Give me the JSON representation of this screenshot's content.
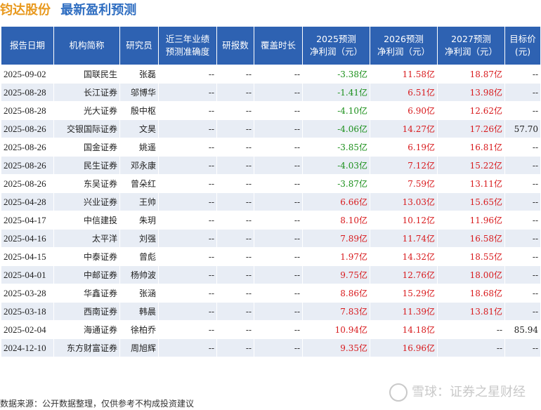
{
  "header": {
    "stock_name": "钧达股份",
    "subtitle": "最新盈利预测"
  },
  "table": {
    "columns": [
      "报告日期",
      "机构简称",
      "研究员",
      "近三年业绩\n预测准确度",
      "研报数",
      "覆盖时长",
      "2025预测\n净利润（元）",
      "2026预测\n净利润（元）",
      "2027预测\n净利润（元）",
      "目标价\n(元)"
    ],
    "rows": [
      [
        "2025-09-02",
        "国联民生",
        "张磊",
        "--",
        "--",
        "--",
        "-3.38亿",
        "11.58亿",
        "18.87亿",
        "--"
      ],
      [
        "2025-08-28",
        "长江证券",
        "邬博华",
        "--",
        "--",
        "--",
        "-1.41亿",
        "6.51亿",
        "13.98亿",
        "--"
      ],
      [
        "2025-08-28",
        "光大证券",
        "殷中枢",
        "--",
        "--",
        "--",
        "-4.10亿",
        "6.90亿",
        "12.62亿",
        "--"
      ],
      [
        "2025-08-26",
        "交银国际证券",
        "文昊",
        "--",
        "--",
        "--",
        "-4.06亿",
        "14.27亿",
        "17.26亿",
        "57.70"
      ],
      [
        "2025-08-26",
        "国金证券",
        "姚遥",
        "--",
        "--",
        "--",
        "-3.85亿",
        "6.19亿",
        "16.81亿",
        "--"
      ],
      [
        "2025-08-26",
        "民生证券",
        "邓永康",
        "--",
        "--",
        "--",
        "-4.03亿",
        "7.12亿",
        "15.22亿",
        "--"
      ],
      [
        "2025-08-26",
        "东吴证券",
        "曾朵红",
        "--",
        "--",
        "--",
        "-3.87亿",
        "7.59亿",
        "13.11亿",
        "--"
      ],
      [
        "2025-04-28",
        "兴业证券",
        "王帅",
        "--",
        "--",
        "--",
        "6.66亿",
        "13.03亿",
        "15.65亿",
        "--"
      ],
      [
        "2025-04-17",
        "中信建投",
        "朱玥",
        "--",
        "--",
        "--",
        "8.10亿",
        "10.12亿",
        "11.96亿",
        "--"
      ],
      [
        "2025-04-16",
        "太平洋",
        "刘强",
        "--",
        "--",
        "--",
        "7.89亿",
        "11.74亿",
        "16.58亿",
        "--"
      ],
      [
        "2025-04-15",
        "中泰证券",
        "曾彪",
        "--",
        "--",
        "--",
        "1.97亿",
        "14.32亿",
        "18.55亿",
        "--"
      ],
      [
        "2025-04-01",
        "中邮证券",
        "杨帅波",
        "--",
        "--",
        "--",
        "9.75亿",
        "12.76亿",
        "18.00亿",
        "--"
      ],
      [
        "2025-03-28",
        "华鑫证券",
        "张涵",
        "--",
        "--",
        "--",
        "8.86亿",
        "15.29亿",
        "18.68亿",
        "--"
      ],
      [
        "2025-03-18",
        "西南证券",
        "韩晨",
        "--",
        "--",
        "--",
        "7.83亿",
        "11.39亿",
        "13.81亿",
        "--"
      ],
      [
        "2025-02-04",
        "海通证券",
        "徐柏乔",
        "--",
        "--",
        "--",
        "10.94亿",
        "14.18亿",
        "--",
        "85.94"
      ],
      [
        "2024-12-10",
        "东方财富证券",
        "周旭辉",
        "--",
        "--",
        "--",
        "9.35亿",
        "16.96亿",
        "--",
        "--"
      ]
    ]
  },
  "footer": {
    "source": "数据来源：公开数据整理，仅供参考不构成投资建议"
  },
  "watermark": {
    "text": "雪球：证券之星财经"
  },
  "colors": {
    "header_bg": "#2e62b2",
    "stripe": "#e8edf5",
    "negative": "#1a8f1a",
    "positive": "#d8191c",
    "stock_name": "#e8991e",
    "subtitle": "#2f6ec1"
  }
}
